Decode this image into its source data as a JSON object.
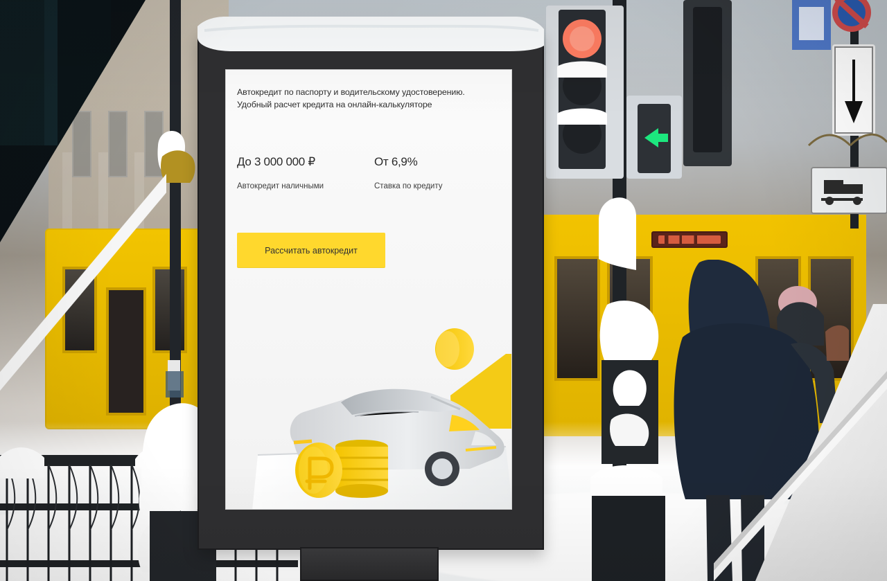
{
  "poster": {
    "headline_lines": [
      "Автокредит по паспорту и водительскому удостоверению.",
      "Удобный расчет кредита на онлайн-калькуляторе"
    ],
    "offers": [
      {
        "value": "До 3 000 000 ₽",
        "caption": "Автокредит наличными"
      },
      {
        "value": "От 6,9%",
        "caption": "Ставка по кредиту"
      }
    ],
    "cta_label": "Рассчитать автокредит"
  },
  "visual": {
    "accent_yellow": "#ffd82d",
    "poster_background": "#f4f4f4",
    "frame_color": "#2f2f31",
    "car_color": "#d8d9db",
    "snow_color": "#ffffff",
    "bus_yellow": "#efc000"
  }
}
